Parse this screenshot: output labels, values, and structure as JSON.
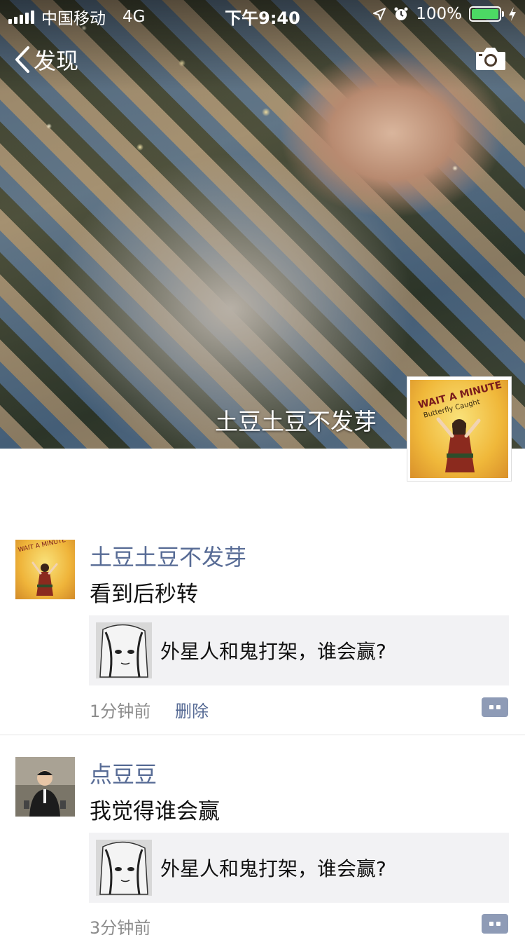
{
  "status_bar": {
    "carrier": "中国移动",
    "network": "4G",
    "time": "下午9:40",
    "battery": "100%",
    "battery_level": 1.0
  },
  "nav": {
    "back_label": "发现"
  },
  "cover": {
    "username": "土豆土豆不发芽",
    "avatar_title": "WAIT A MINUTE",
    "avatar_subtitle": "Butterfly Caught"
  },
  "posts": [
    {
      "name": "土豆土豆不发芽",
      "text": "看到后秒转",
      "shared_title": "外星人和鬼打架，谁会赢?",
      "time": "1分钟前",
      "delete_label": "删除"
    },
    {
      "name": "点豆豆",
      "text": "我觉得谁会赢",
      "shared_title": "外星人和鬼打架，谁会赢?",
      "time": "3分钟前"
    }
  ],
  "colors": {
    "link": "#576b95",
    "battery": "#4cd964",
    "shared_bg": "#f2f2f4"
  }
}
